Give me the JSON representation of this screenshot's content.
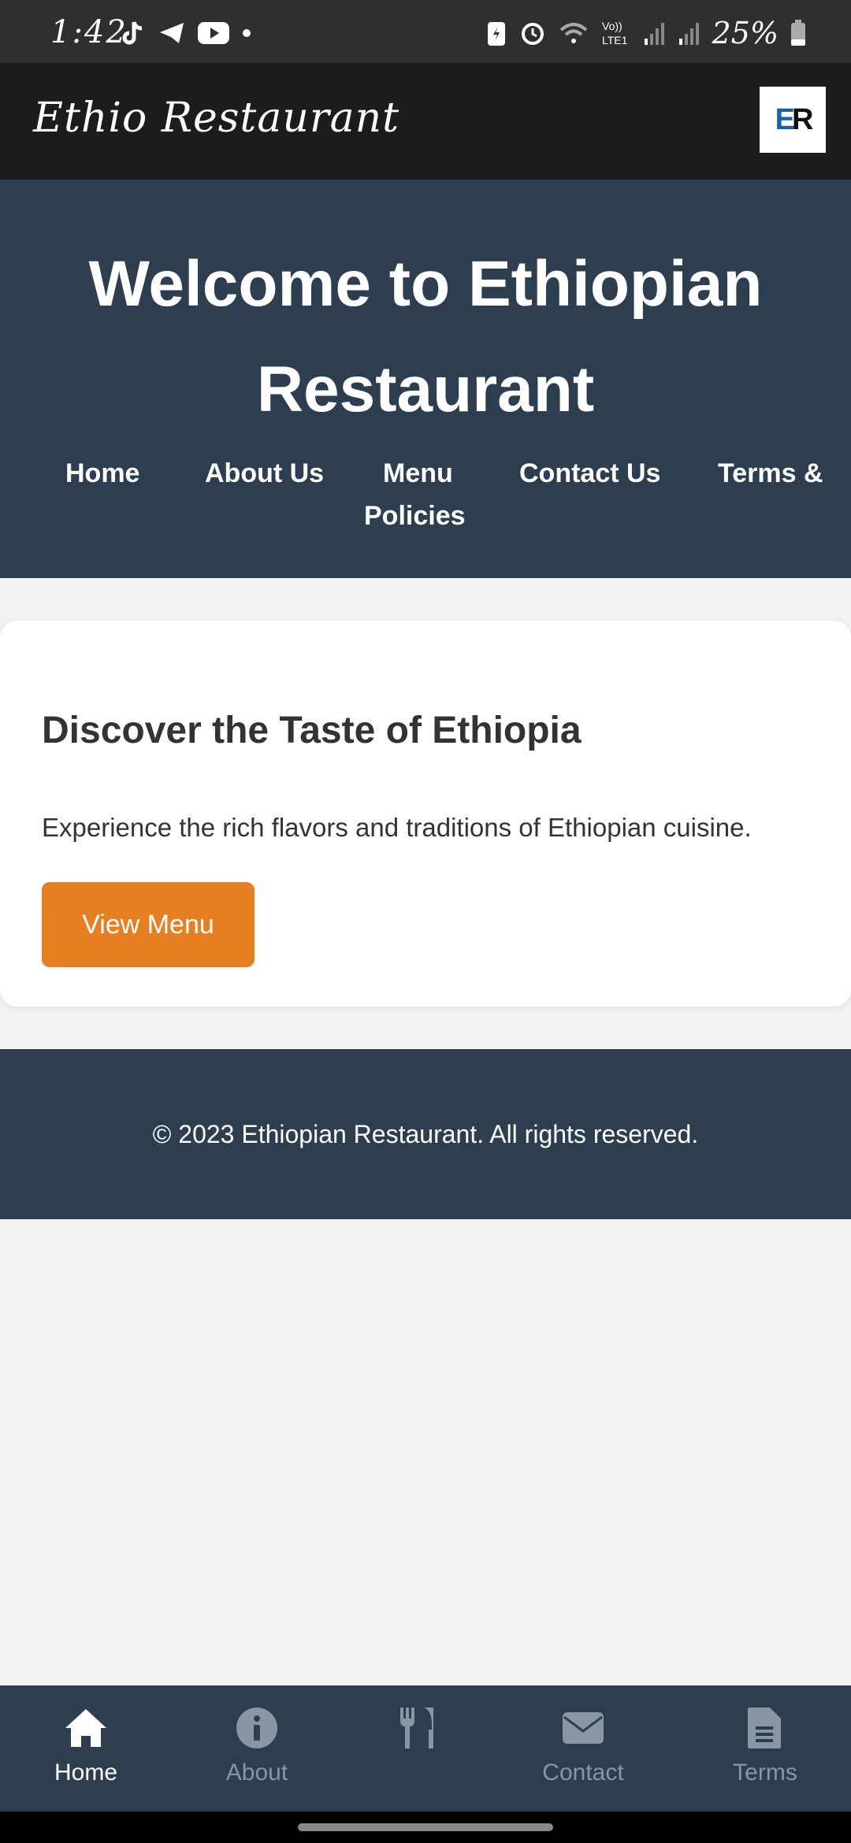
{
  "status_bar": {
    "time": "1:42",
    "battery": "25%",
    "network": "LTE1"
  },
  "app_bar": {
    "brand": "Ethio Restaurant",
    "logo_e": "E",
    "logo_r": "R"
  },
  "hero": {
    "title": "Welcome to Ethiopian Restaurant",
    "nav": [
      "Home",
      "About Us",
      "Menu",
      "Contact Us",
      "Terms &",
      "Policies"
    ]
  },
  "card": {
    "title": "Discover the Taste of Ethiopia",
    "text": "Experience the rich flavors and traditions of Ethiopian cuisine.",
    "button": "View Menu"
  },
  "footer": {
    "text": "© 2023 Ethiopian Restaurant. All rights reserved."
  },
  "bottom_nav": {
    "items": [
      {
        "label": "Home",
        "icon": "home-icon",
        "active": true
      },
      {
        "label": "About",
        "icon": "info-icon",
        "active": false
      },
      {
        "label": "",
        "icon": "utensils-icon",
        "active": false
      },
      {
        "label": "Contact",
        "icon": "envelope-icon",
        "active": false
      },
      {
        "label": "Terms",
        "icon": "document-icon",
        "active": false
      }
    ]
  },
  "colors": {
    "hero_bg": "#2d3e50",
    "accent": "#e67e22",
    "appbar_bg": "#1c1c1c"
  }
}
